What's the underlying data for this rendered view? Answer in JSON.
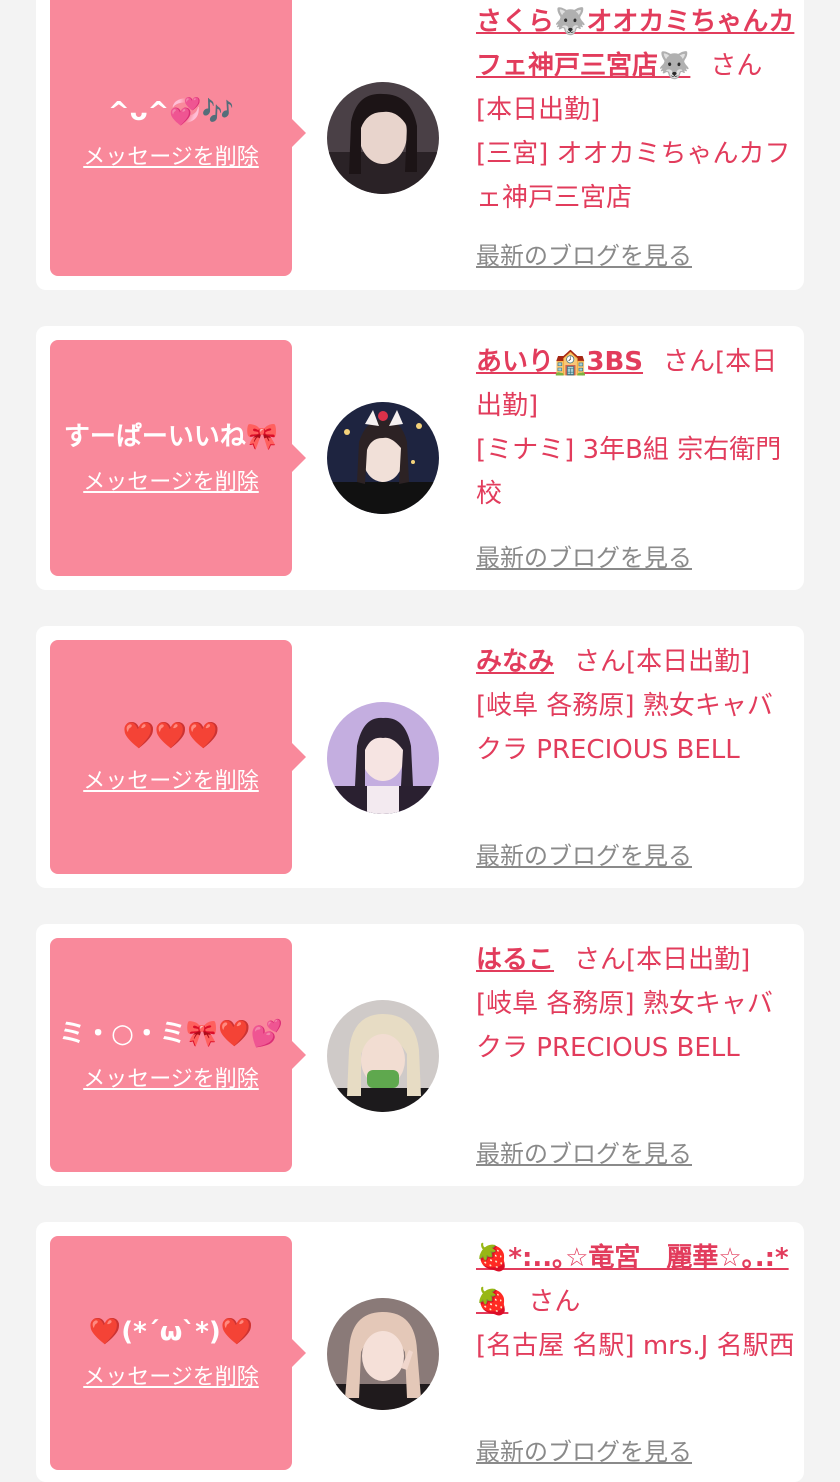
{
  "delete_label": "メッセージを削除",
  "blog_label": "最新のブログを見る",
  "san_label": "さん",
  "colors": {
    "accent": "#e23c5c",
    "bubble": "#f9899b",
    "background": "#f3f3f3"
  },
  "cards": [
    {
      "message": "^ᴗ^💞🎶",
      "name": "さくら🐺オオカミちゃんカフェ神戸三宮店🐺",
      "status": "[本日出勤]",
      "shop": "[三宮] オオカミちゃんカフェ神戸三宮店"
    },
    {
      "message": "すーぱーいいね🎀",
      "name": "あいり🏫3BS",
      "status": "[本日出勤]",
      "shop": "[ミナミ] 3年B組 宗右衛門校"
    },
    {
      "message": "❤️❤️❤️",
      "name": "みなみ",
      "status": "[本日出勤]",
      "shop": "[岐阜 各務原]  熟女キャバクラ PRECIOUS BELL"
    },
    {
      "message": "ミ・○・ミ🎀❤️💕",
      "name": "はるこ",
      "status": "[本日出勤]",
      "shop": "[岐阜 各務原]  熟女キャバクラ PRECIOUS BELL"
    },
    {
      "message": "❤️(*´ω`*)❤️",
      "name": "🍓*:..｡☆竜宮　麗華☆｡.:*🍓",
      "status": "",
      "shop": "[名古屋 名駅] mrs.J 名駅西"
    }
  ]
}
